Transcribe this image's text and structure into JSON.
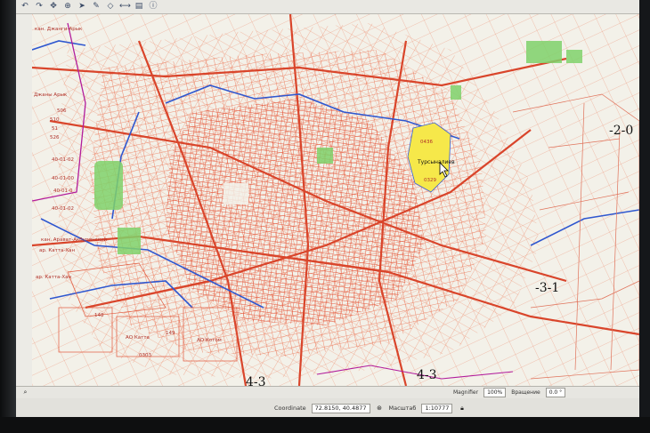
{
  "map": {
    "zone_labels": [
      "-2-0",
      "-3-1",
      "4-3",
      "4-3"
    ],
    "place_labels": [
      "кан. Джанги-Арык",
      "Джаны Арык",
      "кан. Арават-Акбуринский",
      "ар. Катта-Хан",
      "ар. Катта-Хан",
      "Турсыналиев"
    ],
    "parcel_codes": [
      "40-01-02",
      "40-01-00",
      "40-01-0",
      "40-01-02",
      "506",
      "510",
      "51",
      "526",
      "148",
      "0303",
      "149",
      "0436",
      "0329",
      "АО Катта",
      "АО Котом"
    ],
    "parcel_colors": {
      "road": "#e8623a",
      "parcel": "#f08b6b",
      "canal": "#3a5fd1",
      "green": "#7fd26b",
      "highlight": "#f6e84a",
      "boundary": "#b21c9c"
    }
  },
  "status": {
    "coordinate_label": "Coordinate",
    "coordinate_value": "72.8150, 40.4877",
    "scale_label": "Масштаб",
    "scale_value": "1:10777",
    "magnifier_label": "Magnifier",
    "magnifier_value": "100%",
    "rotation_label": "Вращение",
    "rotation_value": "0.0 °"
  },
  "toolbar": {
    "icons": [
      "undo-icon",
      "redo-icon",
      "pan-icon",
      "zoom-icon",
      "select-icon",
      "pencil-icon",
      "node-icon",
      "measure-icon",
      "layer-icon",
      "info-icon"
    ]
  }
}
